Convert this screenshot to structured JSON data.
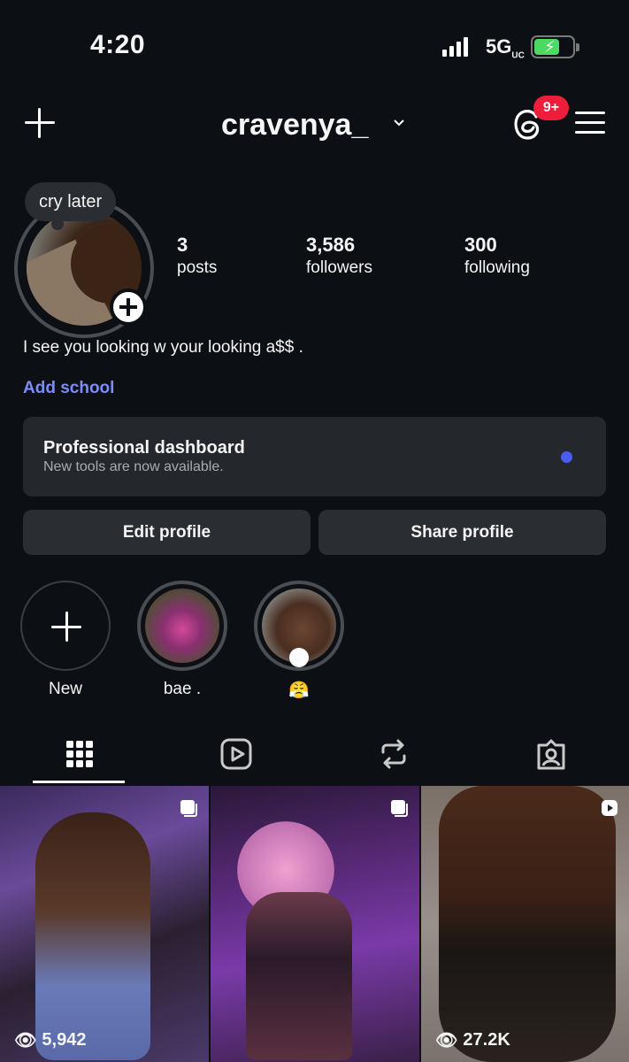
{
  "status_bar": {
    "time": "4:20",
    "network": "5G",
    "network_sub": "UC",
    "battery_charging": true,
    "battery_color": "#4cd964"
  },
  "header": {
    "username": "cravenya_",
    "notification_badge": "9+",
    "badge_color": "#ee1d3a",
    "icons": [
      "plus-icon",
      "chevron-down-icon",
      "threads-icon",
      "menu-icon"
    ]
  },
  "profile": {
    "note": "cry later",
    "stats": [
      {
        "value": "3",
        "label": "posts"
      },
      {
        "value": "3,586",
        "label": "followers"
      },
      {
        "value": "300",
        "label": "following"
      }
    ],
    "bio": "I see you looking w your looking a$$ .",
    "add_school": "Add school",
    "link_color": "#7b8cff"
  },
  "dashboard": {
    "title": "Professional dashboard",
    "subtitle": "New tools are now available.",
    "dot_color": "#4c5cf0"
  },
  "buttons": {
    "edit": "Edit profile",
    "share": "Share profile"
  },
  "highlights": [
    {
      "label": "New"
    },
    {
      "label": "bae ."
    },
    {
      "label": "😤"
    }
  ],
  "tabs": [
    "grid-icon",
    "reels-icon",
    "reposts-icon",
    "tagged-icon"
  ],
  "posts": [
    {
      "views": "5,942",
      "type": "carousel"
    },
    {
      "views": "",
      "type": "carousel"
    },
    {
      "views": "27.2K",
      "type": "reel"
    }
  ]
}
